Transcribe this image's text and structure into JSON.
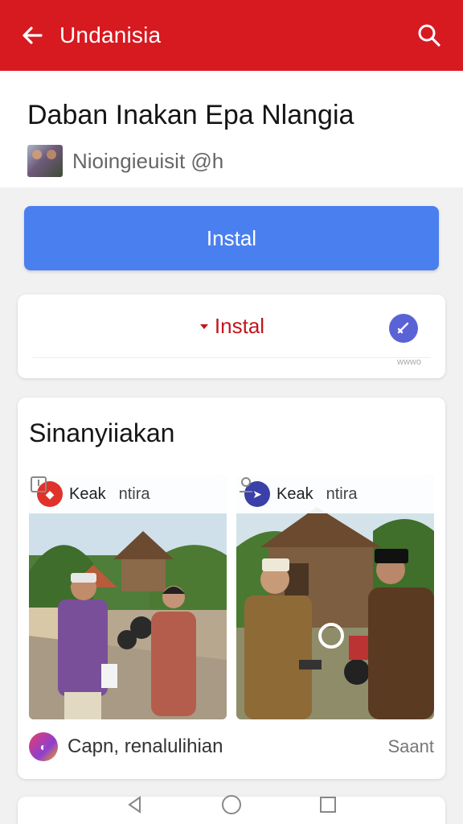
{
  "appbar": {
    "title": "Undanisia",
    "back_icon": "arrow-left-icon",
    "search_icon": "search-icon",
    "color": "#d71920"
  },
  "app": {
    "name": "Daban Inakan Epa Nlangia",
    "developer": "Nioingieuisit @h"
  },
  "install_button": {
    "label": "Instal",
    "color": "#4a7ff0"
  },
  "secondary": {
    "label": "Instal",
    "tiny_text": "wwwo"
  },
  "section": {
    "title": "Sinanyiiakan",
    "photos": [
      {
        "source": "Keak",
        "caption": "ntira"
      },
      {
        "source": "Keak",
        "caption": "ntira"
      }
    ],
    "footer_text": "Capn, renalulihian",
    "footer_right": "Saant"
  }
}
